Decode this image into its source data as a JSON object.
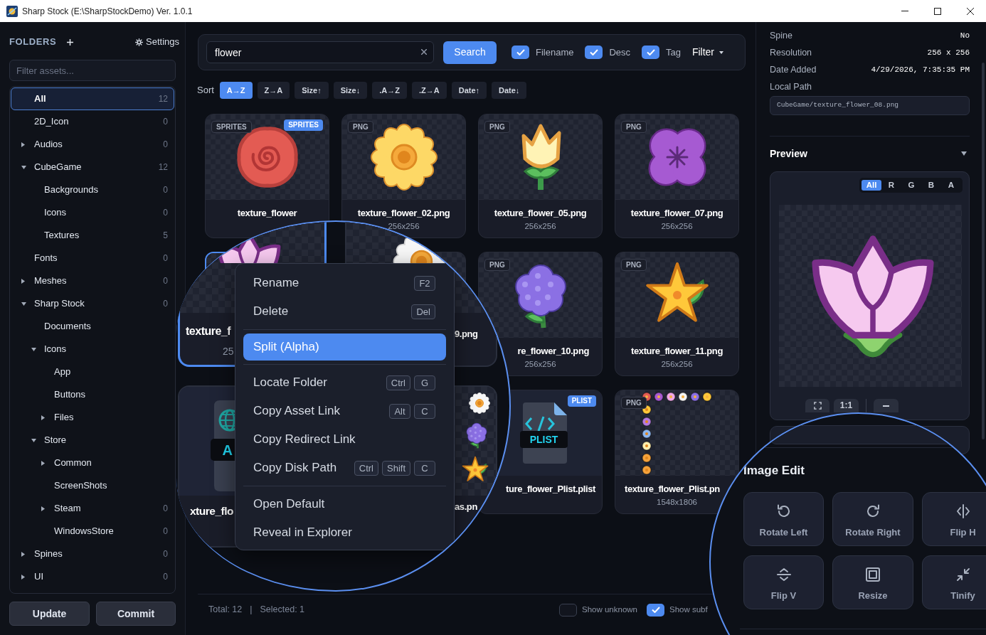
{
  "window": {
    "title": "Sharp Stock (E:\\SharpStockDemo) Ver. 1.0.1"
  },
  "sidebar": {
    "heading": "FOLDERS",
    "settings": "Settings",
    "filter": {
      "placeholder": "Filter assets..."
    },
    "tree": [
      {
        "label": "All",
        "count": "12",
        "selected": true
      },
      {
        "label": "2D_Icon",
        "count": "0",
        "selected": false
      },
      {
        "label": "Audios",
        "count": "0",
        "expanded": false,
        "selected": false
      },
      {
        "label": "CubeGame",
        "count": "12",
        "expanded": true,
        "selected": false,
        "children": [
          {
            "label": "Backgrounds",
            "count": "0",
            "selected": false
          },
          {
            "label": "Icons",
            "count": "0",
            "selected": false
          },
          {
            "label": "Textures",
            "count": "5",
            "selected": false
          }
        ]
      },
      {
        "label": "Fonts",
        "count": "0",
        "selected": false
      },
      {
        "label": "Meshes",
        "count": "0",
        "expanded": false,
        "selected": false
      },
      {
        "label": "Sharp Stock",
        "count": "0",
        "expanded": true,
        "selected": false,
        "children": [
          {
            "label": "Documents",
            "selected": false
          },
          {
            "label": "Icons",
            "expanded": true,
            "selected": false,
            "children": [
              {
                "label": "App",
                "selected": false
              },
              {
                "label": "Buttons",
                "selected": false
              },
              {
                "label": "Files",
                "expanded": false,
                "selected": false
              }
            ]
          },
          {
            "label": "Store",
            "expanded": true,
            "selected": false,
            "children": [
              {
                "label": "Common",
                "expanded": false,
                "selected": false
              },
              {
                "label": "ScreenShots",
                "selected": false
              },
              {
                "label": "Steam",
                "count": "0",
                "expanded": false,
                "selected": false
              },
              {
                "label": "WindowsStore",
                "count": "0",
                "selected": false
              }
            ]
          }
        ]
      },
      {
        "label": "Spines",
        "count": "0",
        "expanded": false,
        "selected": false
      },
      {
        "label": "UI",
        "count": "0",
        "expanded": false,
        "selected": false
      }
    ],
    "buttons": [
      "Update",
      "Commit"
    ]
  },
  "search": {
    "value": "flower",
    "button": "Search",
    "options": [
      {
        "label": "Filename",
        "checked": true
      },
      {
        "label": "Desc",
        "checked": true
      },
      {
        "label": "Tag",
        "checked": true
      }
    ],
    "filter": "Filter"
  },
  "sort": {
    "label": "Sort",
    "options": [
      {
        "label": "A→Z",
        "selected": true
      },
      {
        "label": "Z→A",
        "selected": false
      },
      {
        "label": "Size↑",
        "selected": false
      },
      {
        "label": "Size↓",
        "selected": false
      },
      {
        "label": ".A→Z",
        "selected": false
      },
      {
        "label": ".Z→A",
        "selected": false
      },
      {
        "label": "Date↑",
        "selected": false
      },
      {
        "label": "Date↓",
        "selected": false
      }
    ]
  },
  "grid": {
    "cards": [
      {
        "kind": "image",
        "type": "SPRITES",
        "tag": "SPRITES",
        "name": "texture_flower",
        "selected": false
      },
      {
        "kind": "image",
        "type": "PNG",
        "name": "texture_flower_02.png",
        "dims": "256x256",
        "selected": false
      },
      {
        "kind": "image",
        "type": "PNG",
        "name": "texture_flower_05.png",
        "dims": "256x256",
        "selected": false
      },
      {
        "kind": "image",
        "type": "PNG",
        "name": "texture_flower_07.png",
        "dims": "256x256",
        "selected": false
      },
      {
        "kind": "image",
        "selected": true
      },
      {
        "kind": "image",
        "selected": false
      },
      {
        "kind": "image",
        "type": "PNG",
        "name": "re_flower_10.png",
        "dims": "256x256",
        "selected": false
      },
      {
        "kind": "image",
        "type": "PNG",
        "name": "texture_flower_11.png",
        "dims": "256x256",
        "selected": false
      },
      {
        "kind": "file",
        "tag": "PLIST",
        "file_label": "PLIST",
        "name": "ture_flower_Plist.plist",
        "selected": false
      },
      {
        "kind": "sheet",
        "type": "PNG",
        "name": "texture_flower_Plist.pn",
        "dims": "1548x1806",
        "selected": false
      }
    ]
  },
  "status_bar": {
    "total": "Total: 12",
    "divider": "|",
    "selected": "Selected: 1",
    "toggles": [
      {
        "label": "Show unknown",
        "checked": false
      },
      {
        "label": "Show subf",
        "checked": true
      }
    ]
  },
  "details": {
    "rows": [
      {
        "label": "Spine",
        "value": "No"
      },
      {
        "label": "Resolution",
        "value": "256 x 256"
      },
      {
        "label": "Date Added",
        "value": "4/29/2026, 7:35:35 PM"
      }
    ],
    "path": {
      "label": "Local Path",
      "value": "CubeGame/texture_flower_08.png"
    }
  },
  "preview": {
    "title": "Preview",
    "expanded": true,
    "channels": [
      {
        "label": "All",
        "selected": true
      },
      {
        "label": "R",
        "selected": false
      },
      {
        "label": "G",
        "selected": false
      },
      {
        "label": "B",
        "selected": false
      },
      {
        "label": "A",
        "selected": false
      }
    ],
    "actual_size": "1:1"
  },
  "magnifier_1": {
    "cards": [
      {
        "kind": "image",
        "name": "texture_f",
        "dims": "25",
        "selected": true
      },
      {
        "kind": "image",
        "name": "9.png",
        "selected": false
      },
      {
        "kind": "file",
        "file_label": "A",
        "name": "xture_flo",
        "selected": false
      },
      {
        "kind": "sheet",
        "name": "as.pn",
        "selected": false
      }
    ],
    "menu": {
      "groups": [
        [
          {
            "label": "Rename",
            "keys": [
              "F2"
            ],
            "selected": false
          },
          {
            "label": "Delete",
            "keys": [
              "Del"
            ],
            "selected": false
          }
        ],
        [
          {
            "label": "Split (Alpha)",
            "selected": true
          }
        ],
        [
          {
            "label": "Locate Folder",
            "keys": [
              "Ctrl",
              "G"
            ],
            "selected": false
          },
          {
            "label": "Copy Asset Link",
            "keys": [
              "Alt",
              "C"
            ],
            "selected": false
          },
          {
            "label": "Copy Redirect Link",
            "selected": false
          },
          {
            "label": "Copy Disk Path",
            "keys": [
              "Ctrl",
              "Shift",
              "C"
            ],
            "selected": false
          }
        ],
        [
          {
            "label": "Open Default",
            "selected": false
          },
          {
            "label": "Reveal in Explorer",
            "selected": false
          }
        ]
      ]
    }
  },
  "magnifier_2": {
    "heading": "Image Edit",
    "tools": [
      "Rotate Left",
      "Rotate Right",
      "Flip H",
      "Flip V",
      "Resize",
      "Tinify"
    ]
  }
}
